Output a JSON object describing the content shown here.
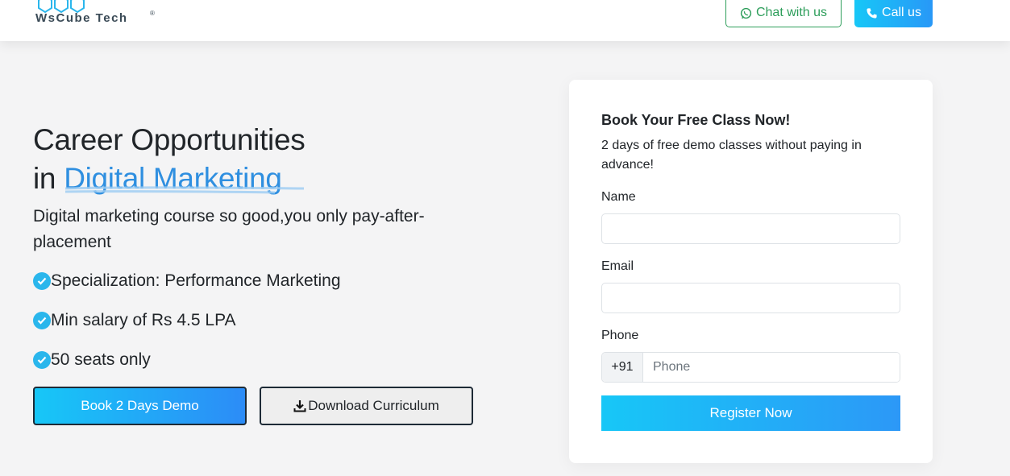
{
  "header": {
    "logo_text_main": "WsCube",
    "logo_text_tech": "Tech",
    "logo_reg": "®",
    "chat_label": "Chat with us",
    "call_label": "Call us"
  },
  "hero": {
    "title_line1": "Career Opportunities",
    "title_in": "in",
    "title_accent": "Digital Marketing",
    "subtitle": "Digital marketing course so good,you only pay-after-placement",
    "features": [
      "Specialization: Performance Marketing",
      "Min salary of Rs 4.5 LPA",
      "50 seats only"
    ],
    "demo_button": "Book 2 Days Demo",
    "download_button": "Download Curriculum"
  },
  "form": {
    "title": "Book Your Free Class Now!",
    "description": "2 days of free demo classes without paying in advance!",
    "name_label": "Name",
    "name_value": "",
    "email_label": "Email",
    "email_value": "",
    "phone_label": "Phone",
    "phone_prefix": "+91",
    "phone_placeholder": "Phone",
    "submit_label": "Register Now"
  },
  "icons": {
    "chat": "whatsapp-icon",
    "call": "phone-icon",
    "feature": "check-circle-icon",
    "download": "download-icon"
  },
  "colors": {
    "accent_blue": "#2f8fe0",
    "gradient_start": "#17c7f7",
    "gradient_end": "#2c8cf7",
    "whatsapp_green": "#2e9e5b"
  }
}
